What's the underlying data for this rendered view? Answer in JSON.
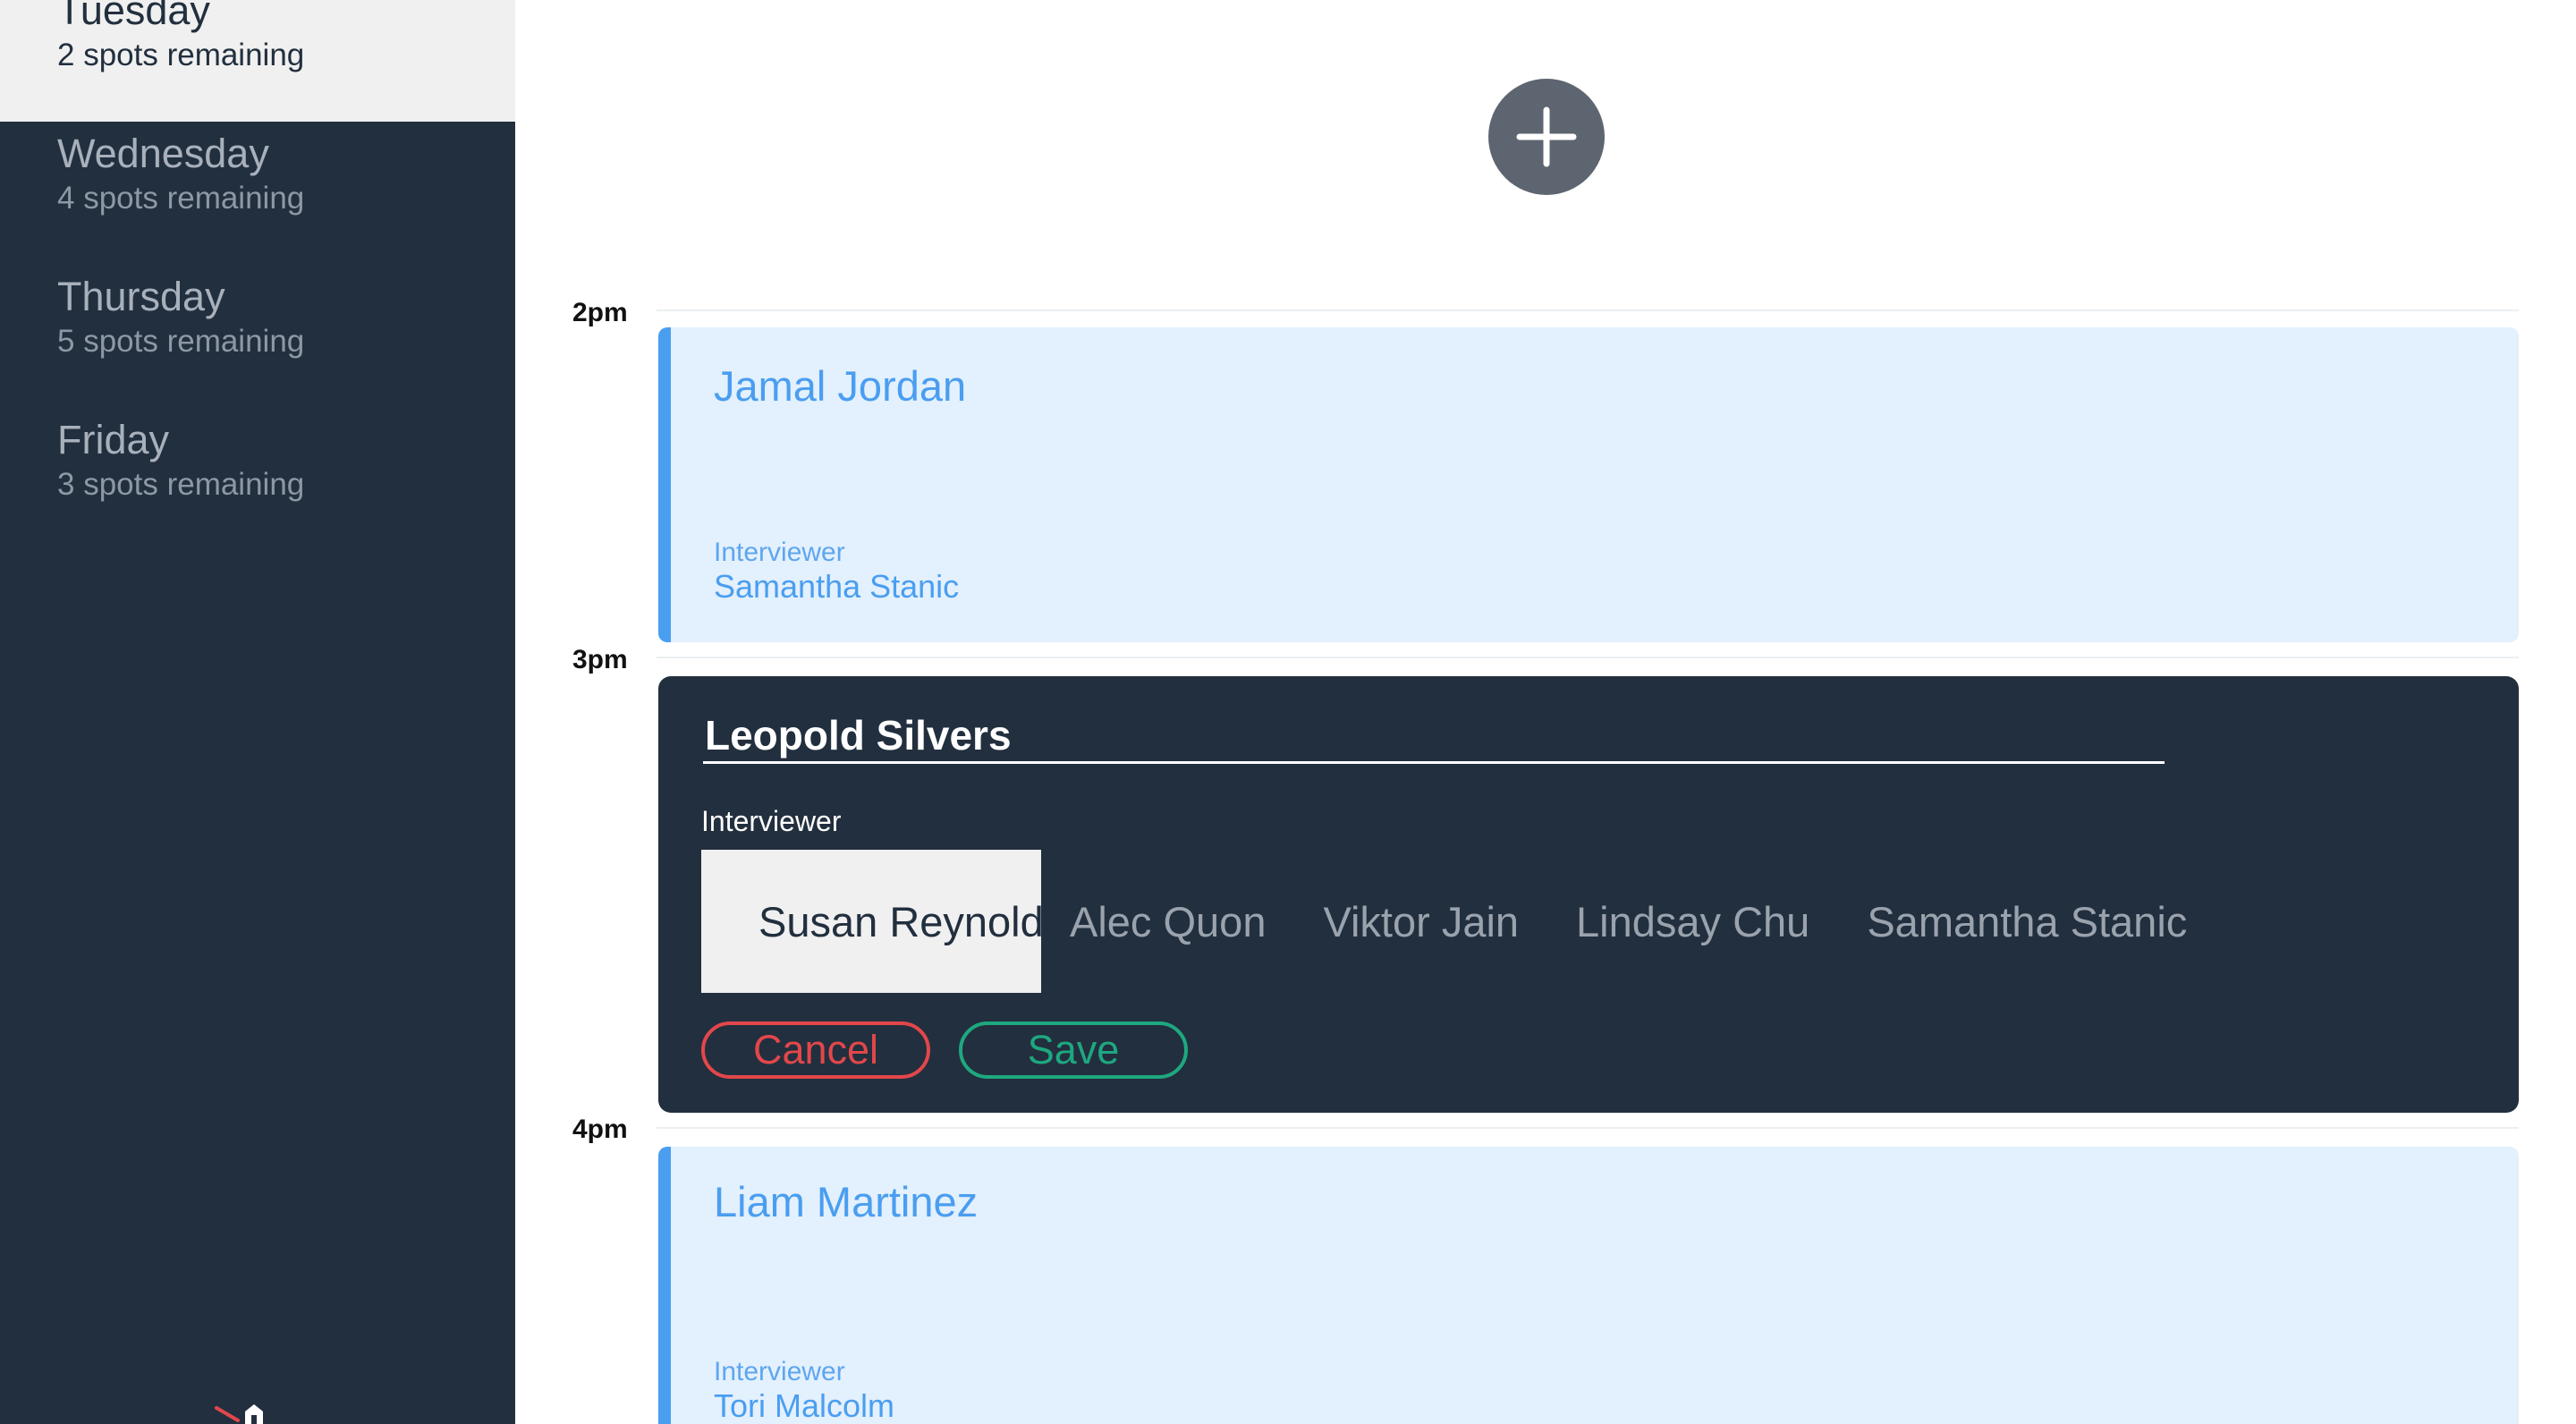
{
  "sidebar": {
    "days": [
      {
        "name": "Tuesday",
        "spots": "2 spots remaining",
        "selected": true
      },
      {
        "name": "Wednesday",
        "spots": "4 spots remaining",
        "selected": false
      },
      {
        "name": "Thursday",
        "spots": "5 spots remaining",
        "selected": false
      },
      {
        "name": "Friday",
        "spots": "3 spots remaining",
        "selected": false
      }
    ]
  },
  "schedule": {
    "hours": [
      "2pm",
      "3pm",
      "4pm"
    ],
    "appointments": [
      {
        "candidate": "Jamal Jordan",
        "interviewer_label": "Interviewer",
        "interviewer": "Samantha Stanic"
      },
      {
        "candidate": "Liam Martinez",
        "interviewer_label": "Interviewer",
        "interviewer": "Tori Malcolm"
      }
    ],
    "editing": {
      "candidate_value": "Leopold Silvers",
      "interviewer_label": "Interviewer",
      "interviewers": [
        "Susan Reynolds",
        "Alec Quon",
        "Viktor Jain",
        "Lindsay Chu",
        "Samantha Stanic"
      ],
      "selected_interviewer": "Susan Reynolds",
      "cancel_label": "Cancel",
      "save_label": "Save"
    }
  },
  "colors": {
    "sidebar_bg": "#222f3e",
    "accent_blue": "#4a9ef0",
    "slot_bg": "#e3f0fd",
    "cancel_red": "#e2474b",
    "save_green": "#1ea87f"
  },
  "icons": {
    "add": "plus-icon",
    "logo": "logo-icon"
  }
}
